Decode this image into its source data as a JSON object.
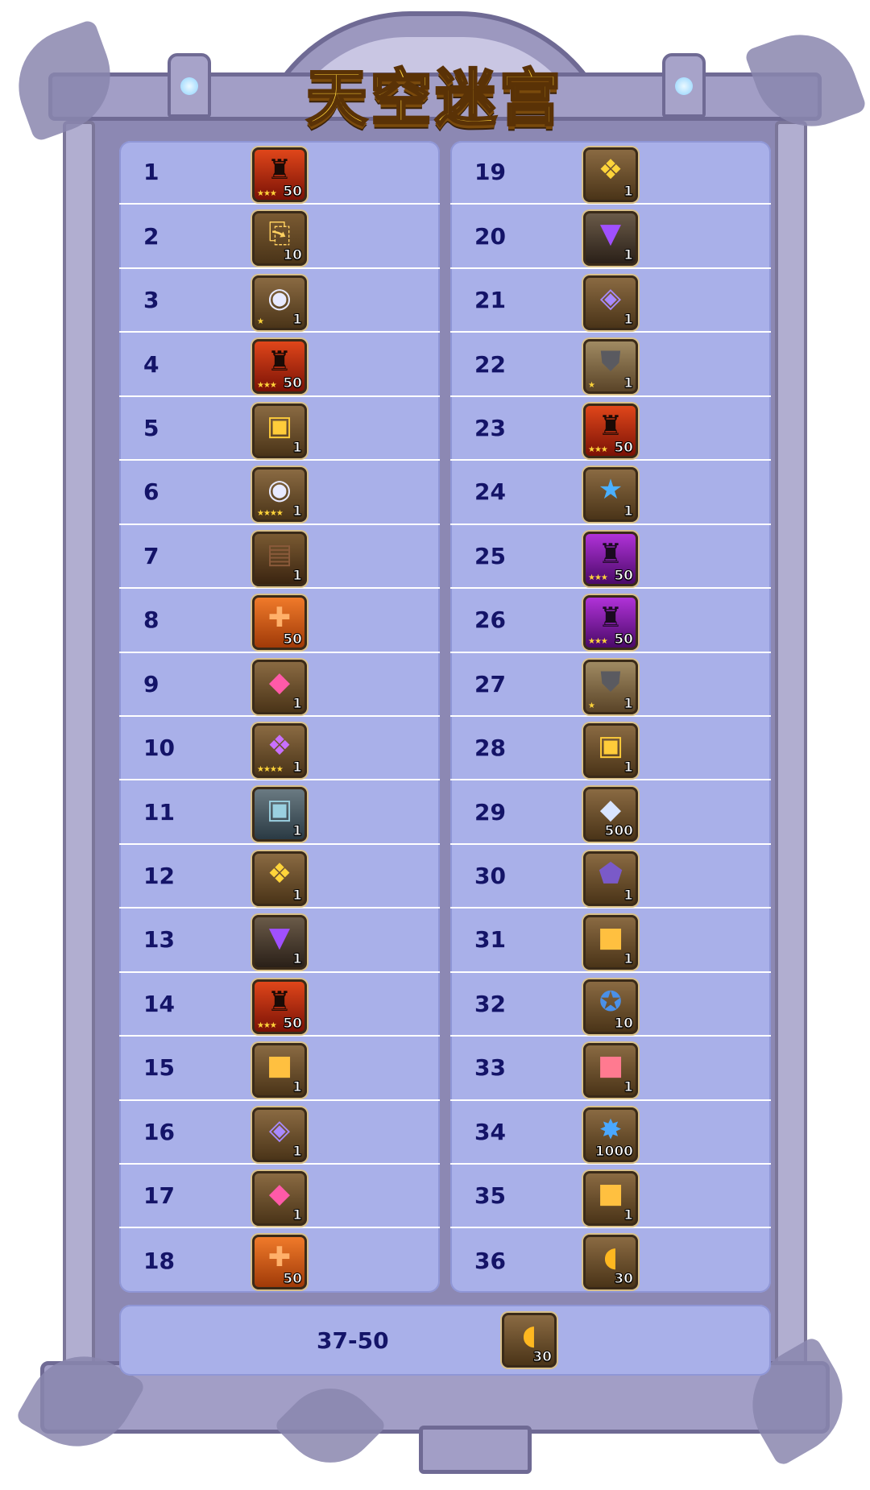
{
  "title": "天空迷宫",
  "colors": {
    "panel": "#a9b0e9",
    "row_divider": "#ffffff",
    "rank_text": "#141468",
    "title_fill": "#ffd43a",
    "frame_stone": "#8c88b3"
  },
  "left_rows": [
    {
      "rank": "1",
      "icon": "hero-fragment-icon",
      "qty": "50",
      "stars": "3"
    },
    {
      "rank": "2",
      "icon": "scroll-icon",
      "qty": "10",
      "stars": ""
    },
    {
      "rank": "3",
      "icon": "orb-chest-icon",
      "qty": "1",
      "stars": "1"
    },
    {
      "rank": "4",
      "icon": "hero-fragment-icon",
      "qty": "50",
      "stars": "3"
    },
    {
      "rank": "5",
      "icon": "gold-chest-icon",
      "qty": "1",
      "stars": ""
    },
    {
      "rank": "6",
      "icon": "orb-chest-icon",
      "qty": "1",
      "stars": "4"
    },
    {
      "rank": "7",
      "icon": "dark-chest-icon",
      "qty": "1",
      "stars": ""
    },
    {
      "rank": "8",
      "icon": "puzzle-piece-icon",
      "qty": "50",
      "stars": ""
    },
    {
      "rank": "9",
      "icon": "pink-gem-chest-icon",
      "qty": "1",
      "stars": ""
    },
    {
      "rank": "10",
      "icon": "winged-chest-icon",
      "qty": "1",
      "stars": "4"
    },
    {
      "rank": "11",
      "icon": "iron-chest-icon",
      "qty": "1",
      "stars": ""
    },
    {
      "rank": "12",
      "icon": "winged-gold-chest-icon",
      "qty": "1",
      "stars": ""
    },
    {
      "rank": "13",
      "icon": "purple-dark-chest-icon",
      "qty": "1",
      "stars": ""
    },
    {
      "rank": "14",
      "icon": "hero-fragment-icon",
      "qty": "50",
      "stars": "3"
    },
    {
      "rank": "15",
      "icon": "gold-cube-chest-icon",
      "qty": "1",
      "stars": ""
    },
    {
      "rank": "16",
      "icon": "crystal-chest-icon",
      "qty": "1",
      "stars": ""
    },
    {
      "rank": "17",
      "icon": "pink-gem-chest-icon",
      "qty": "1",
      "stars": ""
    },
    {
      "rank": "18",
      "icon": "puzzle-piece-icon",
      "qty": "50",
      "stars": ""
    }
  ],
  "right_rows": [
    {
      "rank": "19",
      "icon": "winged-gold-chest-icon",
      "qty": "1",
      "stars": ""
    },
    {
      "rank": "20",
      "icon": "purple-dark-chest-icon",
      "qty": "1",
      "stars": ""
    },
    {
      "rank": "21",
      "icon": "crystal-chest-icon",
      "qty": "1",
      "stars": ""
    },
    {
      "rank": "22",
      "icon": "armor-icon",
      "qty": "1",
      "stars": "1"
    },
    {
      "rank": "23",
      "icon": "hero-fragment-icon",
      "qty": "50",
      "stars": "3"
    },
    {
      "rank": "24",
      "icon": "star-chest-icon",
      "qty": "1",
      "stars": ""
    },
    {
      "rank": "25",
      "icon": "purple-fragment-icon",
      "qty": "50",
      "stars": "3"
    },
    {
      "rank": "26",
      "icon": "purple-fragment-icon",
      "qty": "50",
      "stars": "3"
    },
    {
      "rank": "27",
      "icon": "armor-icon",
      "qty": "1",
      "stars": "1"
    },
    {
      "rank": "28",
      "icon": "gold-chest-icon",
      "qty": "1",
      "stars": ""
    },
    {
      "rank": "29",
      "icon": "diamond-icon",
      "qty": "500",
      "stars": ""
    },
    {
      "rank": "30",
      "icon": "rune-stone-icon",
      "qty": "1",
      "stars": ""
    },
    {
      "rank": "31",
      "icon": "gold-cube-chest-icon",
      "qty": "1",
      "stars": ""
    },
    {
      "rank": "32",
      "icon": "compass-medal-icon",
      "qty": "10",
      "stars": ""
    },
    {
      "rank": "33",
      "icon": "gift-box-icon",
      "qty": "1",
      "stars": ""
    },
    {
      "rank": "34",
      "icon": "blue-star-coin-icon",
      "qty": "1000",
      "stars": ""
    },
    {
      "rank": "35",
      "icon": "gold-cube-chest-icon",
      "qty": "1",
      "stars": ""
    },
    {
      "rank": "36",
      "icon": "gold-coins-icon",
      "qty": "30",
      "stars": ""
    }
  ],
  "bottom_row": {
    "rank": "37-50",
    "icon": "gold-coins-icon",
    "qty": "30",
    "stars": ""
  }
}
